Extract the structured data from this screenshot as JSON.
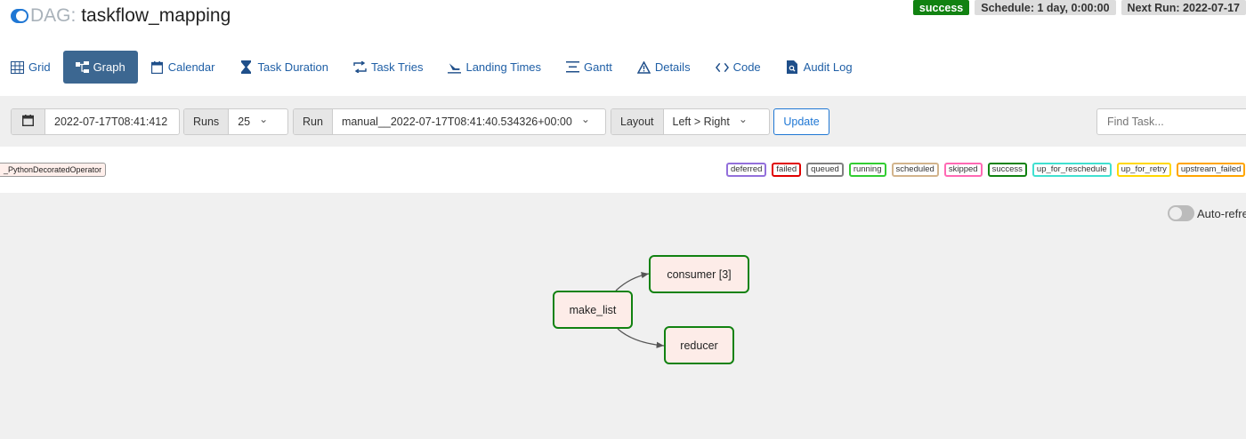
{
  "header": {
    "dag_prefix": "DAG:",
    "dag_name": "taskflow_mapping",
    "status_badge": "success",
    "schedule": "Schedule: 1 day, 0:00:00",
    "next_run": "Next Run: 2022-07-17"
  },
  "nav": {
    "items": [
      {
        "label": "Grid",
        "icon": "grid-icon"
      },
      {
        "label": "Graph",
        "icon": "graph-icon"
      },
      {
        "label": "Calendar",
        "icon": "calendar-icon"
      },
      {
        "label": "Task Duration",
        "icon": "hourglass-icon"
      },
      {
        "label": "Task Tries",
        "icon": "retry-icon"
      },
      {
        "label": "Landing Times",
        "icon": "landing-icon"
      },
      {
        "label": "Gantt",
        "icon": "gantt-icon"
      },
      {
        "label": "Details",
        "icon": "warning-triangle-icon"
      },
      {
        "label": "Code",
        "icon": "code-icon"
      },
      {
        "label": "Audit Log",
        "icon": "audit-log-icon"
      }
    ],
    "active": "Graph"
  },
  "toolbar": {
    "date_value": "2022-07-17T08:41:412",
    "runs_label": "Runs",
    "runs_value": "25",
    "run_label": "Run",
    "run_value": "manual__2022-07-17T08:41:40.534326+00:00",
    "layout_label": "Layout",
    "layout_value": "Left > Right",
    "update_label": "Update",
    "find_placeholder": "Find Task..."
  },
  "legend": {
    "operator": "_PythonDecoratedOperator",
    "states": [
      {
        "label": "deferred",
        "color": "#9370db"
      },
      {
        "label": "failed",
        "color": "#e00000"
      },
      {
        "label": "queued",
        "color": "#808080"
      },
      {
        "label": "running",
        "color": "#32cd32"
      },
      {
        "label": "scheduled",
        "color": "#d2b48c"
      },
      {
        "label": "skipped",
        "color": "#ff69b4"
      },
      {
        "label": "success",
        "color": "#118211"
      },
      {
        "label": "up_for_reschedule",
        "color": "#40e0d0"
      },
      {
        "label": "up_for_retry",
        "color": "#ffd700"
      },
      {
        "label": "upstream_failed",
        "color": "#ffa500"
      }
    ]
  },
  "graph": {
    "auto_refresh_label": "Auto-refresh",
    "nodes": [
      {
        "id": "make_list",
        "label": "make_list"
      },
      {
        "id": "consumer",
        "label": "consumer [3]"
      },
      {
        "id": "reducer",
        "label": "reducer"
      }
    ],
    "edges": [
      {
        "from": "make_list",
        "to": "consumer"
      },
      {
        "from": "make_list",
        "to": "reducer"
      }
    ]
  }
}
